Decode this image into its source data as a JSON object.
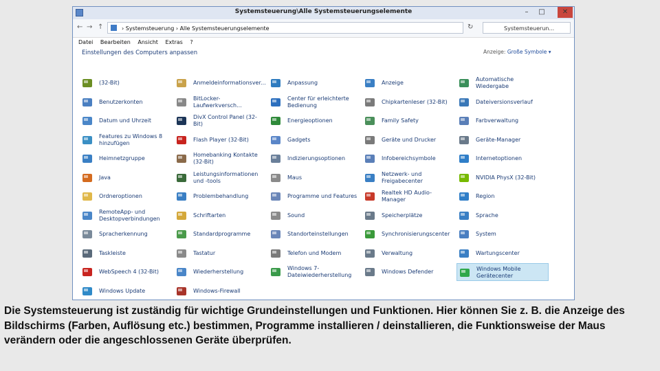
{
  "window": {
    "title": "Systemsteuerung\\Alle Systemsteuerungselemente",
    "buttons": {
      "minimize": "–",
      "maximize": "□",
      "close": "✕"
    }
  },
  "nav": {
    "back": "←",
    "forward": "→",
    "up": "↑"
  },
  "address": {
    "path": "›  Systemsteuerung  ›  Alle Systemsteuerungselemente",
    "refresh": "↻"
  },
  "search": {
    "placeholder": "Systemsteuerun..."
  },
  "menu": [
    "Datei",
    "Bearbeiten",
    "Ansicht",
    "Extras",
    "?"
  ],
  "heading": "Einstellungen des Computers anpassen",
  "view": {
    "label": "Anzeige:",
    "value": "Große Symbole ▾"
  },
  "items": [
    {
      "label": "(32-Bit)",
      "icon": "java-config-icon",
      "color": "#6b8e23"
    },
    {
      "label": "Anmeldeinformationsver...",
      "icon": "credentials-icon",
      "color": "#c9a24a"
    },
    {
      "label": "Anpassung",
      "icon": "personalization-icon",
      "color": "#2e7bbf"
    },
    {
      "label": "Anzeige",
      "icon": "display-icon",
      "color": "#3a7fc4"
    },
    {
      "label": "Automatische Wiedergabe",
      "icon": "autoplay-icon",
      "color": "#3a8f5a"
    },
    {
      "label": "Benutzerkonten",
      "icon": "user-accounts-icon",
      "color": "#4a7fc1"
    },
    {
      "label": "BitLocker-Laufwerkversch...",
      "icon": "bitlocker-icon",
      "color": "#888888"
    },
    {
      "label": "Center für erleichterte Bedienung",
      "icon": "ease-of-access-icon",
      "color": "#2c6fbe"
    },
    {
      "label": "Chipkartenleser (32-Bit)",
      "icon": "smartcard-icon",
      "color": "#7a7a7a"
    },
    {
      "label": "Dateiversionsverlauf",
      "icon": "file-history-icon",
      "color": "#3a78b8"
    },
    {
      "label": "Datum und Uhrzeit",
      "icon": "clock-icon",
      "color": "#4a86c8"
    },
    {
      "label": "DivX Control Panel (32-Bit)",
      "icon": "divx-icon",
      "color": "#1c3557"
    },
    {
      "label": "Energieoptionen",
      "icon": "power-options-icon",
      "color": "#2f8a3a"
    },
    {
      "label": "Family Safety",
      "icon": "family-safety-icon",
      "color": "#4a8f5a"
    },
    {
      "label": "Farbverwaltung",
      "icon": "color-management-icon",
      "color": "#5a7fb8"
    },
    {
      "label": "Features zu Windows 8 hinzufügen",
      "icon": "add-features-icon",
      "color": "#3a8fc4"
    },
    {
      "label": "Flash Player (32-Bit)",
      "icon": "flash-icon",
      "color": "#c8241f"
    },
    {
      "label": "Gadgets",
      "icon": "gadgets-icon",
      "color": "#5a86c8"
    },
    {
      "label": "Geräte und Drucker",
      "icon": "printer-icon",
      "color": "#7a7a7a"
    },
    {
      "label": "Geräte-Manager",
      "icon": "device-manager-icon",
      "color": "#6a7a8a"
    },
    {
      "label": "Heimnetzgruppe",
      "icon": "homegroup-icon",
      "color": "#3a7fc4"
    },
    {
      "label": "Homebanking Kontakte (32-Bit)",
      "icon": "homebanking-icon",
      "color": "#8a6a4a"
    },
    {
      "label": "Indizierungsoptionen",
      "icon": "indexing-icon",
      "color": "#6a7f9a"
    },
    {
      "label": "Infobereichsymbole",
      "icon": "notification-area-icon",
      "color": "#5a7fb8"
    },
    {
      "label": "Internetoptionen",
      "icon": "internet-options-icon",
      "color": "#2f7ec8"
    },
    {
      "label": "Java",
      "icon": "java-icon",
      "color": "#d46b1f"
    },
    {
      "label": "Leistungsinformationen und -tools",
      "icon": "performance-icon",
      "color": "#3a6a3a"
    },
    {
      "label": "Maus",
      "icon": "mouse-icon",
      "color": "#8a8a8a"
    },
    {
      "label": "Netzwerk- und Freigabecenter",
      "icon": "network-icon",
      "color": "#3a7fc4"
    },
    {
      "label": "NVIDIA PhysX (32-Bit)",
      "icon": "nvidia-icon",
      "color": "#76b900"
    },
    {
      "label": "Ordneroptionen",
      "icon": "folder-options-icon",
      "color": "#e0b84a"
    },
    {
      "label": "Problembehandlung",
      "icon": "troubleshooting-icon",
      "color": "#3a7fc4"
    },
    {
      "label": "Programme und Features",
      "icon": "programs-icon",
      "color": "#6a86b8"
    },
    {
      "label": "Realtek HD Audio-Manager",
      "icon": "realtek-audio-icon",
      "color": "#c83a2a"
    },
    {
      "label": "Region",
      "icon": "region-icon",
      "color": "#2f7ec8"
    },
    {
      "label": "RemoteApp- und Desktopverbindungen",
      "icon": "remoteapp-icon",
      "color": "#4a86c8"
    },
    {
      "label": "Schriftarten",
      "icon": "fonts-icon",
      "color": "#d4a83a"
    },
    {
      "label": "Sound",
      "icon": "sound-icon",
      "color": "#8a8a8a"
    },
    {
      "label": "Speicherplätze",
      "icon": "storage-spaces-icon",
      "color": "#6a7a8a"
    },
    {
      "label": "Sprache",
      "icon": "language-icon",
      "color": "#3a7fc4"
    },
    {
      "label": "Spracherkennung",
      "icon": "speech-recognition-icon",
      "color": "#7a8a9a"
    },
    {
      "label": "Standardprogramme",
      "icon": "default-programs-icon",
      "color": "#4a9a4a"
    },
    {
      "label": "Standorteinstellungen",
      "icon": "location-icon",
      "color": "#6a86b8"
    },
    {
      "label": "Synchronisierungscenter",
      "icon": "sync-center-icon",
      "color": "#3a9a3a"
    },
    {
      "label": "System",
      "icon": "system-icon",
      "color": "#4a7fc1"
    },
    {
      "label": "Taskleiste",
      "icon": "taskbar-icon",
      "color": "#5a6a7a"
    },
    {
      "label": "Tastatur",
      "icon": "keyboard-icon",
      "color": "#8a8a8a"
    },
    {
      "label": "Telefon und Modem",
      "icon": "phone-modem-icon",
      "color": "#7a7a7a"
    },
    {
      "label": "Verwaltung",
      "icon": "administrative-tools-icon",
      "color": "#6a7a8a"
    },
    {
      "label": "Wartungscenter",
      "icon": "action-center-icon",
      "color": "#3a7fc4"
    },
    {
      "label": "WebSpeech 4 (32-Bit)",
      "icon": "webspeech-icon",
      "color": "#c8241f"
    },
    {
      "label": "Wiederherstellung",
      "icon": "recovery-icon",
      "color": "#4a86c8"
    },
    {
      "label": "Windows 7-Dateiwiederherstellung",
      "icon": "windows7-backup-icon",
      "color": "#3a9a4a"
    },
    {
      "label": "Windows Defender",
      "icon": "defender-icon",
      "color": "#6a7a8a"
    },
    {
      "label": "Windows Mobile Gerätecenter",
      "icon": "mobile-device-center-icon",
      "color": "#2fa84a",
      "selected": true
    },
    {
      "label": "Windows Update",
      "icon": "windows-update-icon",
      "color": "#2f8ac8"
    },
    {
      "label": "Windows-Firewall",
      "icon": "firewall-icon",
      "color": "#a8342a"
    }
  ],
  "caption": "Die Systemsteuerung ist zuständig für wichtige Grundeinstellungen und Funktionen. Hier können Sie z. B. die Anzeige des Bildschirms (Farben, Auflösung etc.) bestimmen, Programme installieren / deinstallieren, die Funktionsweise der Maus verändern oder die angeschlossenen Geräte überprüfen."
}
